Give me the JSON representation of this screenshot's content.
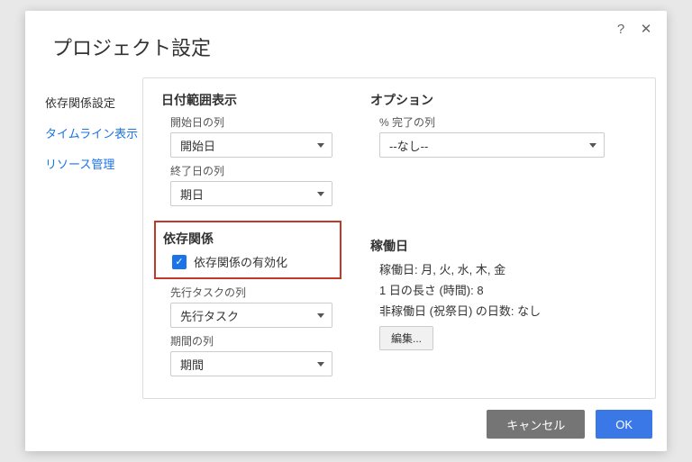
{
  "modal": {
    "title": "プロジェクト設定"
  },
  "sidebar": {
    "items": [
      {
        "label": "依存関係設定",
        "active": true
      },
      {
        "label": "タイムライン表示",
        "active": false
      },
      {
        "label": "リソース管理",
        "active": false
      }
    ]
  },
  "dateRange": {
    "title": "日付範囲表示",
    "startLabel": "開始日の列",
    "startValue": "開始日",
    "endLabel": "終了日の列",
    "endValue": "期日"
  },
  "options": {
    "title": "オプション",
    "percentLabel": "% 完了の列",
    "percentValue": "--なし--"
  },
  "dependency": {
    "title": "依存関係",
    "checkboxLabel": "依存関係の有効化",
    "checked": true,
    "predecessorLabel": "先行タスクの列",
    "predecessorValue": "先行タスク",
    "durationLabel": "期間の列",
    "durationValue": "期間"
  },
  "workdays": {
    "title": "稼働日",
    "daysLine": "稼働日: 月, 火, 水, 木, 金",
    "lengthLine": "1 日の長さ (時間): 8",
    "holidaysLine": "非稼働日 (祝祭日) の日数: なし",
    "editLabel": "編集..."
  },
  "footer": {
    "cancel": "キャンセル",
    "ok": "OK"
  }
}
